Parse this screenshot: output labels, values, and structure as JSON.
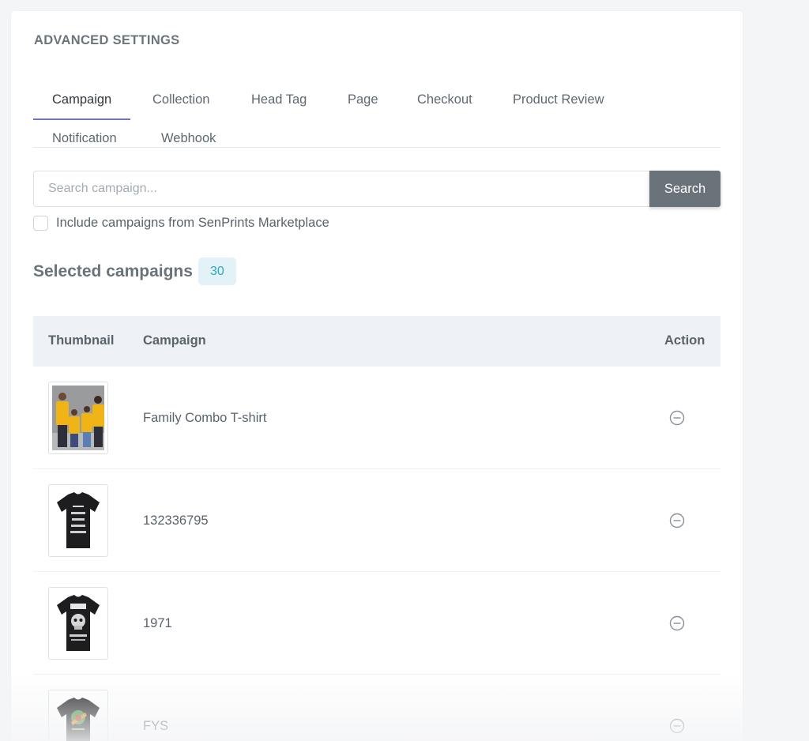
{
  "section_title": "ADVANCED SETTINGS",
  "tabs": [
    {
      "label": "Campaign",
      "active": true
    },
    {
      "label": "Collection"
    },
    {
      "label": "Head Tag"
    },
    {
      "label": "Page"
    },
    {
      "label": "Checkout"
    },
    {
      "label": "Product Review"
    },
    {
      "label": "Notification"
    },
    {
      "label": "Webhook"
    }
  ],
  "search": {
    "placeholder": "Search campaign...",
    "value": "",
    "button_label": "Search"
  },
  "include_marketplace": {
    "label": "Include campaigns from SenPrints Marketplace",
    "checked": false
  },
  "selected": {
    "title": "Selected campaigns",
    "count": "30"
  },
  "table": {
    "headers": {
      "thumbnail": "Thumbnail",
      "campaign": "Campaign",
      "action": "Action"
    },
    "rows": [
      {
        "name": "Family Combo T-shirt",
        "thumb": "yellow-family-shirts-photo"
      },
      {
        "name": "132336795",
        "thumb": "black-tshirt-text-print"
      },
      {
        "name": "1971",
        "thumb": "black-tshirt-1971-skull"
      },
      {
        "name": "FYS",
        "thumb": "black-tshirt-colorful-print"
      }
    ]
  },
  "icons": {
    "remove": "minus-circle-icon"
  },
  "colors": {
    "active_tab_underline": "#6b74c9",
    "search_button": "#6b737a",
    "badge_bg": "#e3f2f7",
    "badge_text": "#2ba8c4",
    "table_header_bg": "#eef1f5"
  }
}
